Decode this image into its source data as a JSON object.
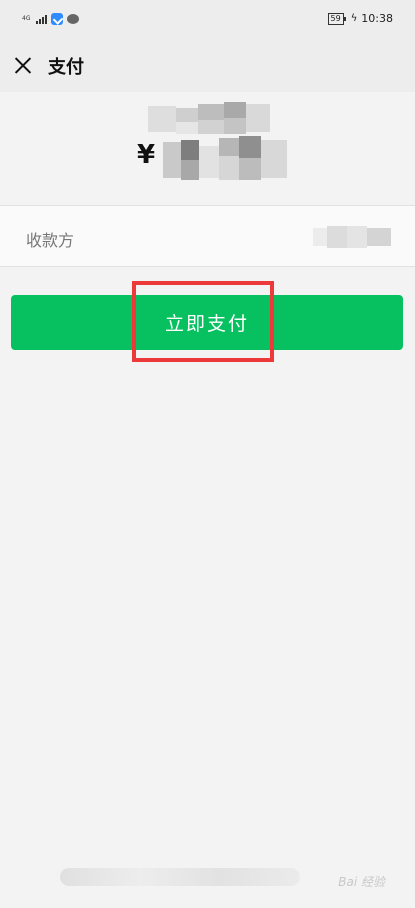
{
  "status_bar": {
    "network_label": "4G",
    "time": "10:38",
    "battery_level": "59",
    "app_icons": [
      "notification-app-icon",
      "message-icon"
    ]
  },
  "nav": {
    "title": "支付",
    "close_icon": "close-icon"
  },
  "amount": {
    "currency_symbol": "¥"
  },
  "payee": {
    "label": "收款方"
  },
  "actions": {
    "pay_now_label": "立即支付"
  },
  "colors": {
    "primary_button": "#07c160",
    "highlight_box": "#ec3a3a",
    "background": "#f3f3f3"
  }
}
